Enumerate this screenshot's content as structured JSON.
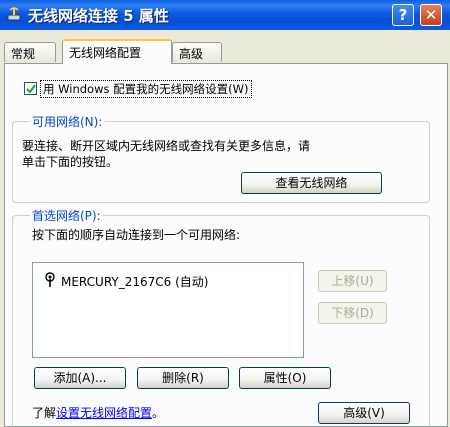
{
  "window": {
    "title": "无线网络连接 5 属性",
    "help_button": "?",
    "close_button": "✕"
  },
  "tabs": [
    {
      "label": "常规"
    },
    {
      "label": "无线网络配置"
    },
    {
      "label": "高级"
    }
  ],
  "use_windows_checkbox": {
    "checked": true,
    "label": "用 Windows 配置我的无线网络设置(W)"
  },
  "available_networks": {
    "legend": "可用网络(N):",
    "description_line1": "要连接、断开区域内无线网络或查找有关更多信息，请",
    "description_line2": "单击下面的按钮。",
    "view_button": "查看无线网络"
  },
  "preferred_networks": {
    "legend": "首选网络(P):",
    "description": "按下面的顺序自动连接到一个可用网络:",
    "items": [
      {
        "name": "MERCURY_2167C6 (自动)",
        "icon": "wireless-antenna-icon"
      }
    ],
    "move_up_button": "上移(U)",
    "move_down_button": "下移(D)",
    "add_button": "添加(A)...",
    "remove_button": "删除(R)",
    "properties_button": "属性(O)"
  },
  "footer": {
    "learn_prefix": "了解",
    "learn_link": "设置无线网络配置",
    "learn_suffix": "。",
    "advanced_button": "高级(V)"
  }
}
